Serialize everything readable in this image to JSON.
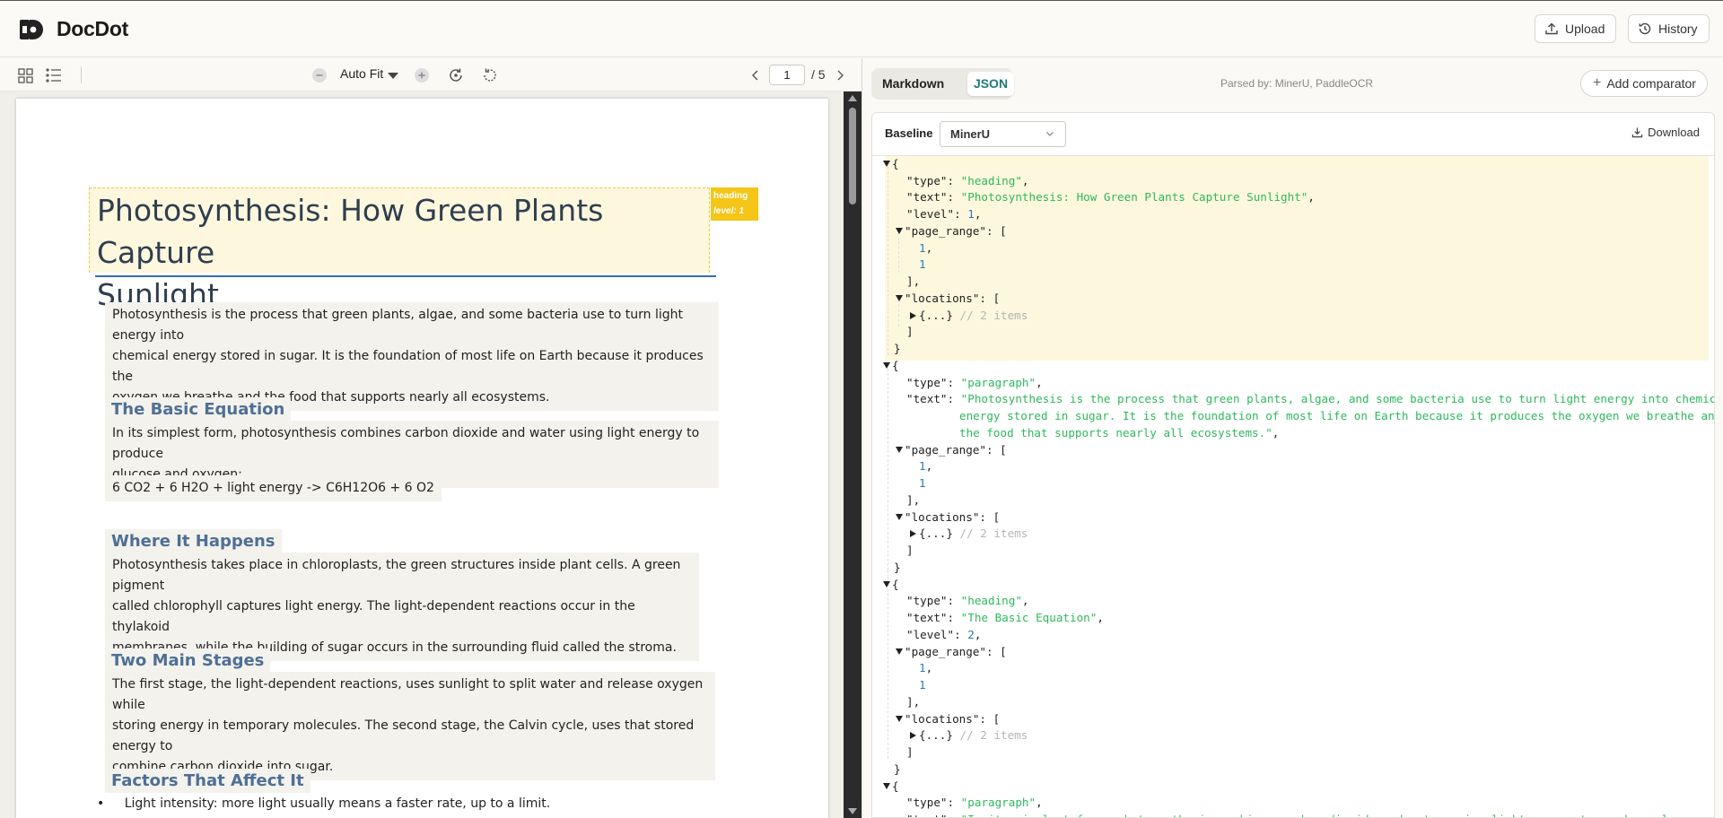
{
  "app": {
    "name": "DocDot"
  },
  "header": {
    "upload_label": "Upload",
    "history_label": "History"
  },
  "viewer_toolbar": {
    "zoom_label": "Auto Fit",
    "page_current": "1",
    "page_total": "/ 5"
  },
  "document": {
    "title_line1": "Photosynthesis: How Green Plants Capture",
    "title_line2": "Sunlight",
    "tag_type": "heading",
    "tag_level": "level: 1",
    "intro_lines": [
      "Photosynthesis is the process that green plants, algae, and some bacteria use to turn light energy into",
      "chemical energy stored in sugar. It is the foundation of most life on Earth because it produces the",
      "oxygen we breathe and the food that supports nearly all ecosystems."
    ],
    "h_basic": "The Basic Equation",
    "basic_lines": [
      "In its simplest form, photosynthesis combines carbon dioxide and water using light energy to produce",
      "glucose and oxygen:"
    ],
    "equation": "6 CO2 + 6 H2O + light energy -> C6H12O6 + 6 O2",
    "h_where": "Where It Happens",
    "where_lines": [
      "Photosynthesis takes place in chloroplasts, the green structures inside plant cells. A green pigment",
      "called chlorophyll captures light energy. The light-dependent reactions occur in the thylakoid",
      "membranes, while the building of sugar occurs in the surrounding fluid called the stroma."
    ],
    "h_stages": "Two Main Stages",
    "stages_lines": [
      "The first stage, the light-dependent reactions, uses sunlight to split water and release oxygen while",
      "storing energy in temporary molecules. The second stage, the Calvin cycle, uses that stored energy to",
      "combine carbon dioxide into sugar."
    ],
    "h_factors": "Factors That Affect It",
    "bullet_1": "Light intensity: more light usually means a faster rate, up to a limit."
  },
  "right_panel": {
    "tab_markdown": "Markdown",
    "tab_json": "JSON",
    "parsed_by": "Parsed by:  MinerU, PaddleOCR",
    "add_comparator": "Add comparator",
    "baseline_label": "Baseline",
    "baseline_value": "MinerU",
    "download_label": "Download"
  },
  "json_lines": [
    "{",
    "  \"type\": \"heading\",",
    "  \"text\": \"Photosynthesis: How Green Plants Capture Sunlight\",",
    "  \"level\": 1,",
    "\"page_range\": [",
    "  1,",
    "  1",
    "],",
    "\"locations\": [",
    "{...} // 2 items",
    "]",
    "}",
    "{",
    "  \"type\": \"paragraph\",",
    "  \"text\": \"Photosynthesis is the process that green plants, algae, and some bacteria use to turn light energy into chemical",
    "energy stored in sugar. It is the foundation of most life on Earth because it produces the oxygen we breathe and",
    "the food that supports nearly all ecosystems.\",",
    "\"page_range\": [",
    "  1,",
    "  1",
    "],",
    "\"locations\": [",
    "{...} // 2 items",
    "]",
    "}",
    "{",
    "  \"type\": \"heading\",",
    "  \"text\": \"The Basic Equation\",",
    "  \"level\": 2,",
    "\"page_range\": [",
    "  1,",
    "  1",
    "],",
    "\"locations\": [",
    "{...} // 2 items",
    "]",
    "}",
    "{",
    "  \"type\": \"paragraph\",",
    "  \"text\": \"In its simplest form, photosynthesis combines carbon dioxide and water using light energy to produce glucose and"
  ],
  "colors": {
    "accent": "#1e7a7a",
    "highlight": "#fdf7dd",
    "tag": "#f5c518",
    "string": "#2eb85c",
    "number": "#2a7ab8"
  }
}
